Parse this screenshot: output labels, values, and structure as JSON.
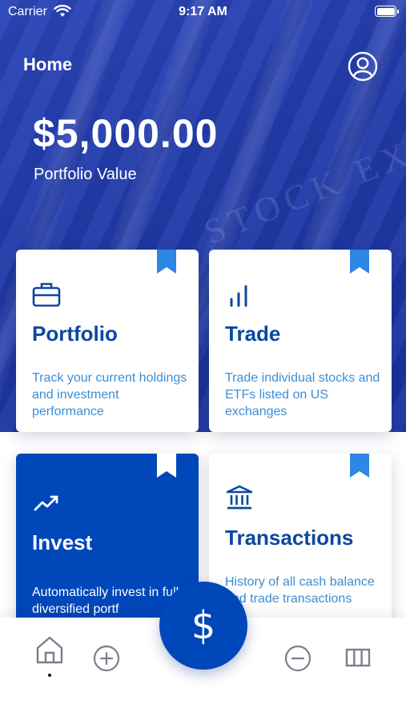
{
  "status_bar": {
    "carrier": "Carrier",
    "time": "9:17 AM",
    "wifi_icon": "wifi-icon",
    "battery_icon": "battery-icon"
  },
  "header": {
    "title": "Home",
    "profile_icon": "user-circle-icon"
  },
  "portfolio": {
    "value": "$5,000.00",
    "label": "Portfolio Value"
  },
  "cards": [
    {
      "title": "Portfolio",
      "description": "Track your current holdings and investment performance",
      "icon": "briefcase-icon",
      "highlighted": false
    },
    {
      "title": "Trade",
      "description": "Trade individual stocks and ETFs listed on US exchanges",
      "icon": "bar-chart-icon",
      "highlighted": false
    },
    {
      "title": "Invest",
      "description": "Automatically invest in fully diversified portf",
      "icon": "trend-line-icon",
      "highlighted": true
    },
    {
      "title": "Transactions",
      "description": "History of all cash balance and trade transactions",
      "icon": "bank-icon",
      "highlighted": false
    }
  ],
  "tab_bar": {
    "items": [
      "home-icon",
      "plus-circle-icon",
      "dollar-icon",
      "minus-circle-icon",
      "columns-icon"
    ],
    "fab_symbol": "$"
  },
  "colors": {
    "brand_blue": "#0047ba",
    "hero_blue": "#213aa8",
    "title_blue": "#0d47a1",
    "desc_blue": "#3b8ed6",
    "bookmark_blue": "#2e86e6"
  }
}
